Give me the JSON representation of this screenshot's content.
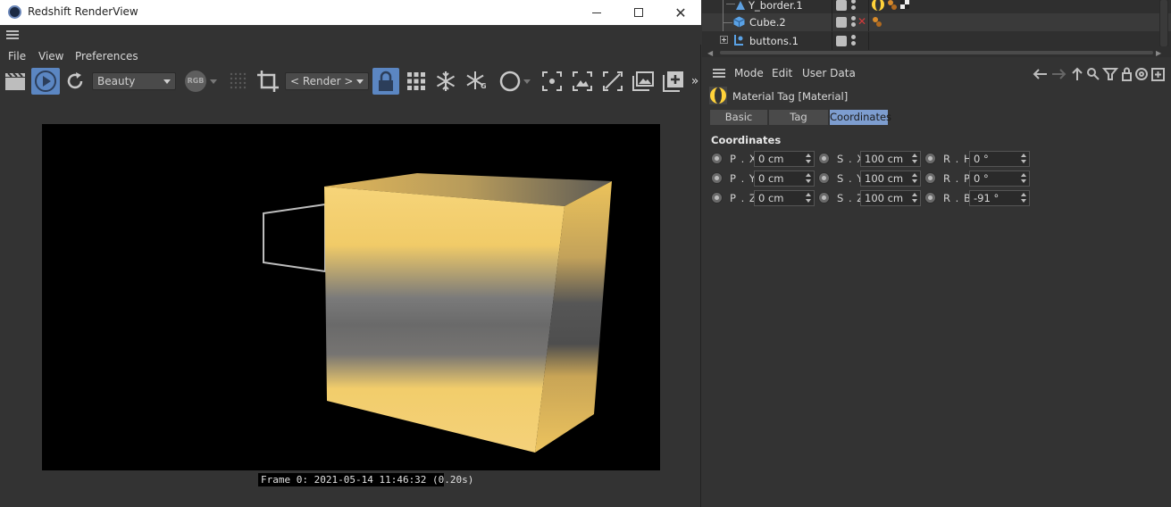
{
  "window": {
    "title": "Redshift RenderView",
    "minimize": "—",
    "maximize": "☐",
    "close": "✕"
  },
  "menu": {
    "file": "File",
    "view": "View",
    "preferences": "Preferences"
  },
  "toolbar": {
    "aov_selected": "Beauty",
    "rgb_label": "RGB",
    "camera_selected": "< Render >",
    "overflow": "»",
    "snowflake_g": "G"
  },
  "status": {
    "frame_text": "Frame  0: 2021-05-14 11:46:32 (0.20s)"
  },
  "object_manager": {
    "rows": [
      {
        "name": "Y_border.1"
      },
      {
        "name": "Cube.2"
      },
      {
        "name": "buttons.1"
      }
    ]
  },
  "attributes": {
    "menu": {
      "mode": "Mode",
      "edit": "Edit",
      "user_data": "User Data"
    },
    "tag_title": "Material Tag [Material]",
    "tabs": [
      "Basic",
      "Tag",
      "Coordinates"
    ],
    "active_tab": "Coordinates",
    "section_title": "Coordinates",
    "fields": {
      "px": {
        "label": "P . X",
        "value": "0 cm"
      },
      "py": {
        "label": "P . Y",
        "value": "0 cm"
      },
      "pz": {
        "label": "P . Z",
        "value": "0 cm"
      },
      "sx": {
        "label": "S . X",
        "value": "100 cm"
      },
      "sy": {
        "label": "S . Y",
        "value": "100 cm"
      },
      "sz": {
        "label": "S . Z",
        "value": "100 cm"
      },
      "rh": {
        "label": "R . H",
        "value": "0 °"
      },
      "rp": {
        "label": "R . P",
        "value": "0 °"
      },
      "rb": {
        "label": "R . B",
        "value": "-91 °"
      }
    }
  },
  "colors": {
    "accent": "#5b86c2",
    "tab_active": "#7d9dcf",
    "panel_bg": "#333333",
    "viewport_bg": "#000000",
    "cube_yellow": "#f4cf6e",
    "cube_grey": "#6c6c6c"
  }
}
